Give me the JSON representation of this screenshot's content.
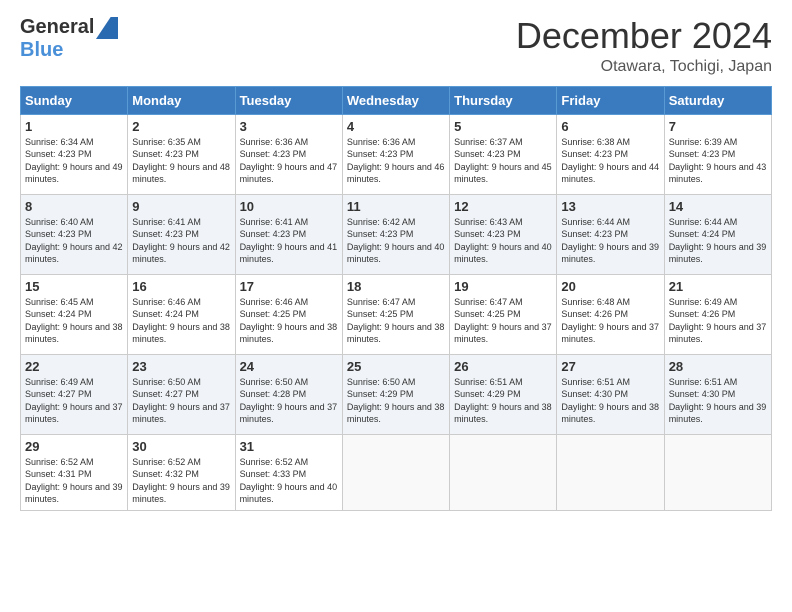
{
  "header": {
    "logo_general": "General",
    "logo_blue": "Blue",
    "month_title": "December 2024",
    "location": "Otawara, Tochigi, Japan"
  },
  "weekdays": [
    "Sunday",
    "Monday",
    "Tuesday",
    "Wednesday",
    "Thursday",
    "Friday",
    "Saturday"
  ],
  "weeks": [
    [
      {
        "day": 1,
        "sunrise": "6:34 AM",
        "sunset": "4:23 PM",
        "daylight": "9 hours and 49 minutes."
      },
      {
        "day": 2,
        "sunrise": "6:35 AM",
        "sunset": "4:23 PM",
        "daylight": "9 hours and 48 minutes."
      },
      {
        "day": 3,
        "sunrise": "6:36 AM",
        "sunset": "4:23 PM",
        "daylight": "9 hours and 47 minutes."
      },
      {
        "day": 4,
        "sunrise": "6:36 AM",
        "sunset": "4:23 PM",
        "daylight": "9 hours and 46 minutes."
      },
      {
        "day": 5,
        "sunrise": "6:37 AM",
        "sunset": "4:23 PM",
        "daylight": "9 hours and 45 minutes."
      },
      {
        "day": 6,
        "sunrise": "6:38 AM",
        "sunset": "4:23 PM",
        "daylight": "9 hours and 44 minutes."
      },
      {
        "day": 7,
        "sunrise": "6:39 AM",
        "sunset": "4:23 PM",
        "daylight": "9 hours and 43 minutes."
      }
    ],
    [
      {
        "day": 8,
        "sunrise": "6:40 AM",
        "sunset": "4:23 PM",
        "daylight": "9 hours and 42 minutes."
      },
      {
        "day": 9,
        "sunrise": "6:41 AM",
        "sunset": "4:23 PM",
        "daylight": "9 hours and 42 minutes."
      },
      {
        "day": 10,
        "sunrise": "6:41 AM",
        "sunset": "4:23 PM",
        "daylight": "9 hours and 41 minutes."
      },
      {
        "day": 11,
        "sunrise": "6:42 AM",
        "sunset": "4:23 PM",
        "daylight": "9 hours and 40 minutes."
      },
      {
        "day": 12,
        "sunrise": "6:43 AM",
        "sunset": "4:23 PM",
        "daylight": "9 hours and 40 minutes."
      },
      {
        "day": 13,
        "sunrise": "6:44 AM",
        "sunset": "4:23 PM",
        "daylight": "9 hours and 39 minutes."
      },
      {
        "day": 14,
        "sunrise": "6:44 AM",
        "sunset": "4:24 PM",
        "daylight": "9 hours and 39 minutes."
      }
    ],
    [
      {
        "day": 15,
        "sunrise": "6:45 AM",
        "sunset": "4:24 PM",
        "daylight": "9 hours and 38 minutes."
      },
      {
        "day": 16,
        "sunrise": "6:46 AM",
        "sunset": "4:24 PM",
        "daylight": "9 hours and 38 minutes."
      },
      {
        "day": 17,
        "sunrise": "6:46 AM",
        "sunset": "4:25 PM",
        "daylight": "9 hours and 38 minutes."
      },
      {
        "day": 18,
        "sunrise": "6:47 AM",
        "sunset": "4:25 PM",
        "daylight": "9 hours and 38 minutes."
      },
      {
        "day": 19,
        "sunrise": "6:47 AM",
        "sunset": "4:25 PM",
        "daylight": "9 hours and 37 minutes."
      },
      {
        "day": 20,
        "sunrise": "6:48 AM",
        "sunset": "4:26 PM",
        "daylight": "9 hours and 37 minutes."
      },
      {
        "day": 21,
        "sunrise": "6:49 AM",
        "sunset": "4:26 PM",
        "daylight": "9 hours and 37 minutes."
      }
    ],
    [
      {
        "day": 22,
        "sunrise": "6:49 AM",
        "sunset": "4:27 PM",
        "daylight": "9 hours and 37 minutes."
      },
      {
        "day": 23,
        "sunrise": "6:50 AM",
        "sunset": "4:27 PM",
        "daylight": "9 hours and 37 minutes."
      },
      {
        "day": 24,
        "sunrise": "6:50 AM",
        "sunset": "4:28 PM",
        "daylight": "9 hours and 37 minutes."
      },
      {
        "day": 25,
        "sunrise": "6:50 AM",
        "sunset": "4:29 PM",
        "daylight": "9 hours and 38 minutes."
      },
      {
        "day": 26,
        "sunrise": "6:51 AM",
        "sunset": "4:29 PM",
        "daylight": "9 hours and 38 minutes."
      },
      {
        "day": 27,
        "sunrise": "6:51 AM",
        "sunset": "4:30 PM",
        "daylight": "9 hours and 38 minutes."
      },
      {
        "day": 28,
        "sunrise": "6:51 AM",
        "sunset": "4:30 PM",
        "daylight": "9 hours and 39 minutes."
      }
    ],
    [
      {
        "day": 29,
        "sunrise": "6:52 AM",
        "sunset": "4:31 PM",
        "daylight": "9 hours and 39 minutes."
      },
      {
        "day": 30,
        "sunrise": "6:52 AM",
        "sunset": "4:32 PM",
        "daylight": "9 hours and 39 minutes."
      },
      {
        "day": 31,
        "sunrise": "6:52 AM",
        "sunset": "4:33 PM",
        "daylight": "9 hours and 40 minutes."
      },
      null,
      null,
      null,
      null
    ]
  ]
}
